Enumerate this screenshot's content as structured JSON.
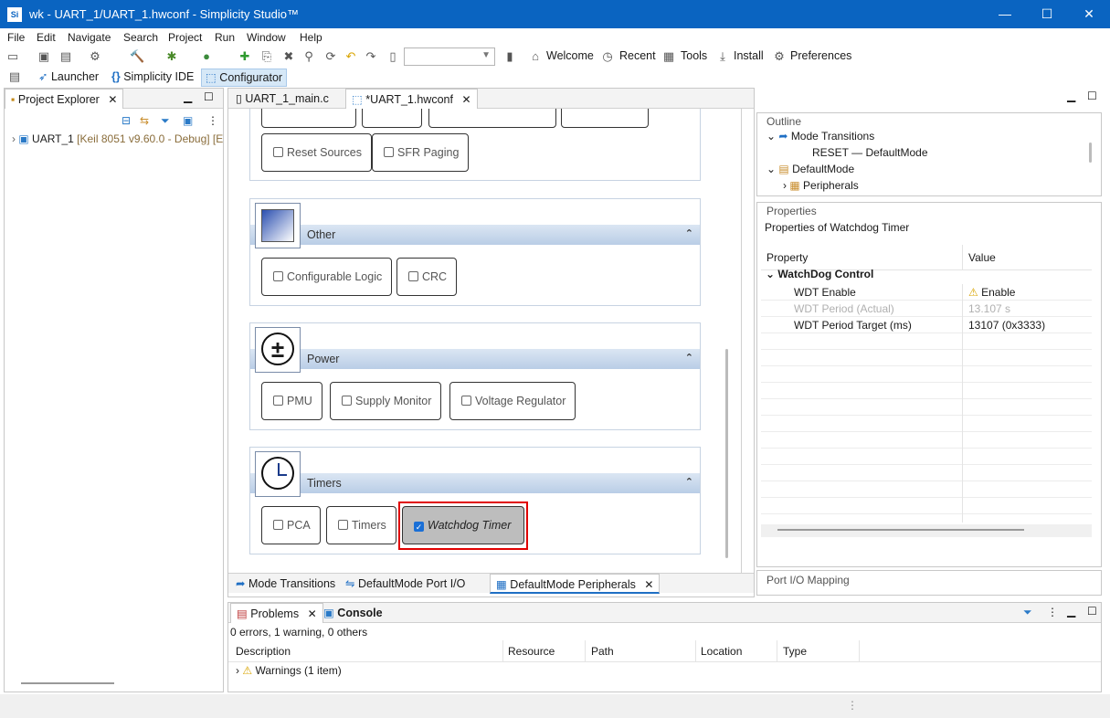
{
  "window": {
    "title": "wk - UART_1/UART_1.hwconf - Simplicity Studio™",
    "app_icon": "Si",
    "minimize": "—",
    "maximize": "☐",
    "close": "✕"
  },
  "menu": [
    "File",
    "Edit",
    "Navigate",
    "Search",
    "Project",
    "Run",
    "Window",
    "Help"
  ],
  "toolbar": {
    "welcome": "Welcome",
    "recent": "Recent",
    "tools": "Tools",
    "install": "Install",
    "preferences": "Preferences",
    "combo_value": ""
  },
  "perspectives": {
    "launcher": "Launcher",
    "ide": "Simplicity IDE",
    "configurator": "Configurator"
  },
  "project_explorer": {
    "tab": "Project Explorer",
    "tree": [
      {
        "name": "UART_1",
        "detail": "[Keil 8051 v9.60.0 - Debug] [E"
      }
    ]
  },
  "editor": {
    "tabs": [
      {
        "label": "UART_1_main.c"
      },
      {
        "label": "*UART_1.hwconf"
      }
    ],
    "sections": [
      {
        "title": "Other",
        "buttons": [
          "Configurable Logic",
          "CRC"
        ]
      },
      {
        "title": "Power",
        "icon_symbol": "±",
        "buttons": [
          "PMU",
          "Supply Monitor",
          "Voltage Regulator"
        ]
      },
      {
        "title": "Timers",
        "buttons": [
          "PCA",
          "Timers",
          "Watchdog Timer"
        ]
      }
    ],
    "top_buttons": [
      "Reset Sources",
      "SFR Paging"
    ],
    "checked_button": "Watchdog Timer",
    "bottom_tabs": [
      "Mode Transitions",
      "DefaultMode Port I/O",
      "DefaultMode Peripherals"
    ]
  },
  "outline": {
    "title": "Outline",
    "items": [
      {
        "label": "Mode Transitions"
      },
      {
        "label": "RESET — DefaultMode"
      },
      {
        "label": "DefaultMode"
      },
      {
        "label": "Peripherals"
      }
    ]
  },
  "properties": {
    "title": "Properties",
    "subtitle": "Properties of Watchdog Timer",
    "col_property": "Property",
    "col_value": "Value",
    "group": "WatchDog Control",
    "rows": [
      {
        "name": "WDT Enable",
        "value": "Enable"
      },
      {
        "name": "WDT Period (Actual)",
        "value": "13.107 s"
      },
      {
        "name": "WDT Period Target (ms)",
        "value": "13107 (0x3333)"
      }
    ]
  },
  "port_io": {
    "title": "Port I/O Mapping"
  },
  "problems": {
    "tabs": [
      "Problems",
      "Console"
    ],
    "summary": "0 errors, 1 warning, 0 others",
    "columns": [
      "Description",
      "Resource",
      "Path",
      "Location",
      "Type"
    ],
    "rows": [
      {
        "description": "Warnings (1 item)"
      }
    ]
  },
  "colors": {
    "titlebar": "#0a64c1",
    "selection_highlight": "#e00000",
    "section_header": "#c6d6ea"
  }
}
